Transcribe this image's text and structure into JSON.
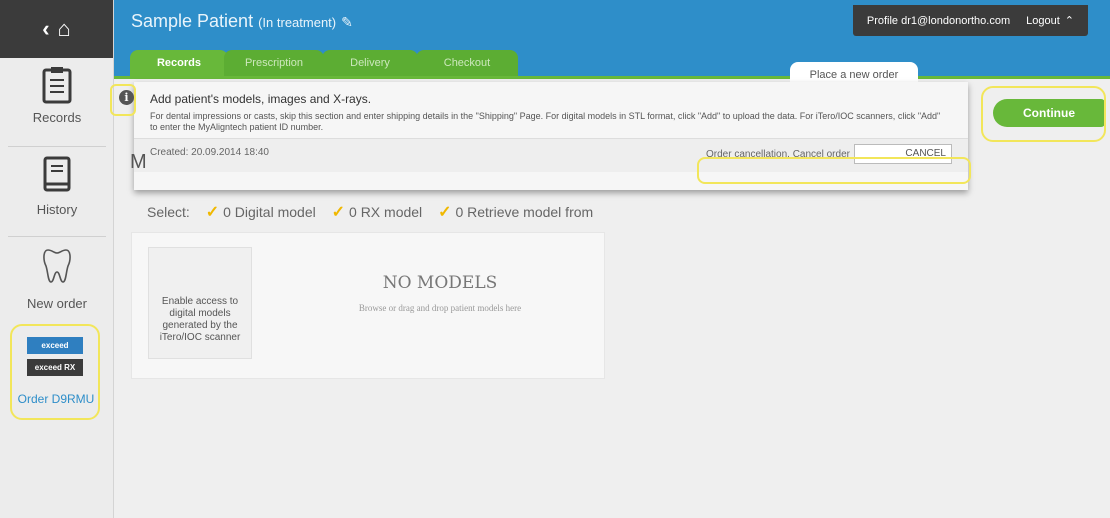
{
  "header": {
    "patient_name": "Sample Patient",
    "patient_status": "(In treatment)",
    "profile_label": "Profile dr1@londonortho.com",
    "logout_label": "Logout"
  },
  "tabs": [
    {
      "label": "Records",
      "active": true
    },
    {
      "label": "Prescription",
      "active": false
    },
    {
      "label": "Delivery",
      "active": false
    },
    {
      "label": "Checkout",
      "active": false
    }
  ],
  "place_order": "Place a new order",
  "continue_label": "Continue",
  "info": {
    "title": "Add patient's models, images and X-rays.",
    "body": "For dental impressions or casts, skip this section and enter shipping details in the \"Shipping\" Page. For digital models in STL format, click \"Add\" to upload the data. For iTero/IOC scanners, click \"Add\" to enter the MyAligntech patient ID number.",
    "created": "Created: 20.09.2014 18:40",
    "cancellation_text": "Order cancellation. Cancel order",
    "cancel_button": "CANCEL"
  },
  "sidebar": {
    "records": "Records",
    "history": "History",
    "new_order": "New order",
    "badge1": "exceed",
    "badge2": "exceed RX",
    "order_label": "Order D9RMU"
  },
  "main": {
    "heading_partial": "M",
    "select_label": "Select:",
    "digital_model": "0 Digital model",
    "rx_model": "0 RX model",
    "retrieve_model": "0 Retrieve model from",
    "enable_access": "Enable access to digital models generated by the iTero/IOC scanner",
    "no_models": "NO MODELS",
    "browse_hint": "Browse or drag and drop patient models here"
  },
  "colors": {
    "header_blue": "#2e8ec9",
    "tab_green": "#68b83a",
    "highlight_yellow": "#f2e65a",
    "check_orange": "#f0b800"
  }
}
